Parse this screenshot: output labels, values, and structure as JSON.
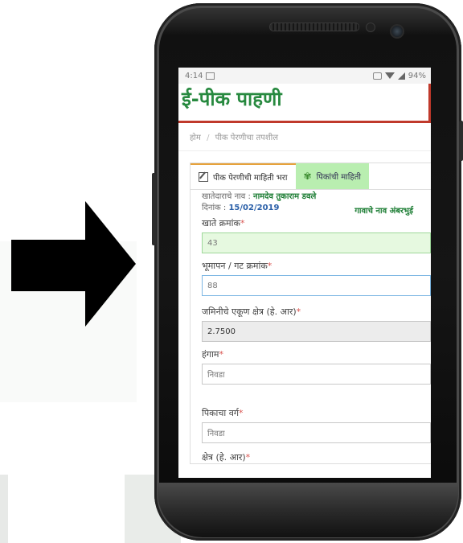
{
  "status_bar": {
    "time": "4:14",
    "battery": "94%"
  },
  "app": {
    "title": "ई-पीक पाहणी"
  },
  "breadcrumb": {
    "home": "होम",
    "current": "पीक पेरणीचा तपशील"
  },
  "tabs": [
    {
      "label": "पीक पेरणीची माहिती भरा",
      "icon": "pencil-icon"
    },
    {
      "label": "पिकांची माहिती",
      "icon": "leaf-icon"
    }
  ],
  "info": {
    "owner_label": "खातेदाराचे नाव :",
    "owner_name": "नामदेव तुकाराम डवले",
    "date_label": "दिनांक :",
    "date_value": "15/02/2019",
    "village_label": "गावाचे नाव अंबरभुई"
  },
  "fields": [
    {
      "label": "खाते क्रमांक",
      "value": "43"
    },
    {
      "label": "भूमापन / गट क्रमांक",
      "value": "88"
    },
    {
      "label": "जमिनीचे एकूण क्षेत्र (हे. आर)",
      "value": "2.7500"
    },
    {
      "label": "हंगाम",
      "value": "निवडा"
    },
    {
      "label": "पिकाचा वर्ग",
      "value": "निवडा"
    },
    {
      "label": "क्षेत्र (हे. आर)",
      "value": ""
    }
  ],
  "colors": {
    "brand_green": "#27893f",
    "accent_red": "#c0392b",
    "tab_green": "#b9eeb0"
  }
}
